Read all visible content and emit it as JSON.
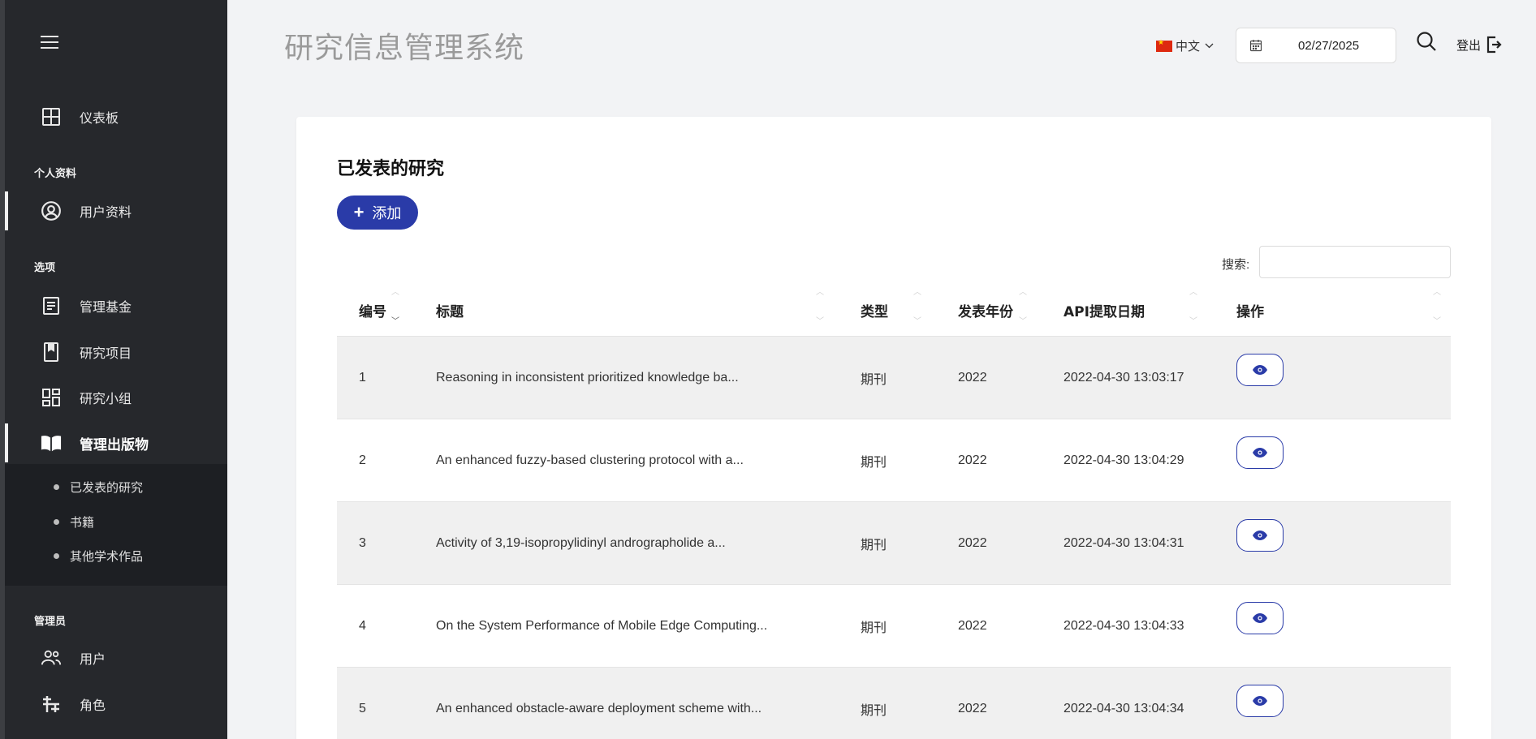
{
  "app": {
    "title": "研究信息管理系统"
  },
  "header": {
    "language": "中文",
    "date_value": "02/27/2025",
    "logout_label": "登出"
  },
  "sidebar": {
    "dashboard": "仪表板",
    "section_profile": "个人资料",
    "user_profile": "用户资料",
    "section_options": "选项",
    "manage_funds": "管理基金",
    "research_projects": "研究项目",
    "research_groups": "研究小组",
    "manage_publications": "管理出版物",
    "sub_items": [
      "已发表的研究",
      "书籍",
      "其他学术作品"
    ],
    "section_admin": "管理员",
    "users": "用户",
    "roles": "角色"
  },
  "main": {
    "card_title": "已发表的研究",
    "add_label": "添加",
    "search_label": "搜索:",
    "search_value": "",
    "columns": [
      "编号",
      "标题",
      "类型",
      "发表年份",
      "API提取日期",
      "操作"
    ],
    "rows": [
      {
        "id": "1",
        "title": "Reasoning in inconsistent prioritized knowledge ba...",
        "type": "期刊",
        "year": "2022",
        "date": "2022-04-30 13:03:17"
      },
      {
        "id": "2",
        "title": "An enhanced fuzzy-based clustering protocol with a...",
        "type": "期刊",
        "year": "2022",
        "date": "2022-04-30 13:04:29"
      },
      {
        "id": "3",
        "title": "Activity of 3,19-isopropylidinyl andrographolide a...",
        "type": "期刊",
        "year": "2022",
        "date": "2022-04-30 13:04:31"
      },
      {
        "id": "4",
        "title": "On the System Performance of Mobile Edge Computing...",
        "type": "期刊",
        "year": "2022",
        "date": "2022-04-30 13:04:33"
      },
      {
        "id": "5",
        "title": "An enhanced obstacle-aware deployment scheme with...",
        "type": "期刊",
        "year": "2022",
        "date": "2022-04-30 13:04:34"
      }
    ]
  },
  "colors": {
    "primary": "#2a3ba8",
    "sidebar_bg": "#26282c",
    "page_bg": "#f2f3f5"
  }
}
